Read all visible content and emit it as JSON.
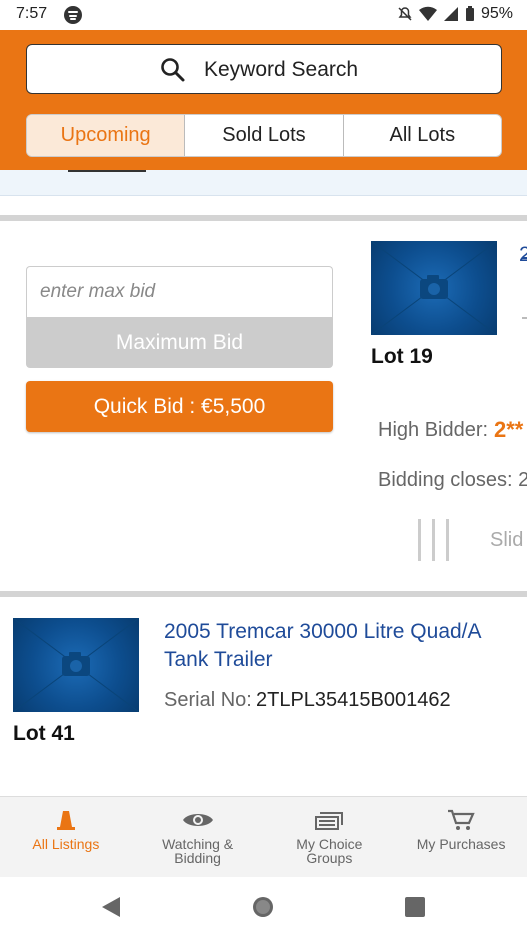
{
  "status_bar": {
    "time": "7:57",
    "battery": "95%"
  },
  "search": {
    "placeholder": "Keyword Search"
  },
  "tabs": [
    {
      "label": "Upcoming",
      "active": true
    },
    {
      "label": "Sold Lots",
      "active": false
    },
    {
      "label": "All Lots",
      "active": false
    }
  ],
  "card1": {
    "max_bid_placeholder": "enter max bid",
    "max_bid_button": "Maximum Bid",
    "quick_bid_button": "Quick Bid : €5,500",
    "title_fragment": "2",
    "lot": "Lot 19",
    "high_bidder_label": "High Bidder:",
    "high_bidder_value": "2**",
    "bidding_closes_label": "Bidding closes: 2",
    "slide_text": "Slid"
  },
  "card2": {
    "title": "2005 Tremcar 30000 Litre Quad/A Tank Trailer",
    "serial_label": "Serial No:",
    "serial_value": "2TLPL35415B001462",
    "lot": "Lot 41"
  },
  "bottom_nav": [
    {
      "label": "All Listings",
      "icon": "cone-icon",
      "active": true
    },
    {
      "label": "Watching & Bidding",
      "icon": "eye-icon",
      "active": false
    },
    {
      "label": "My Choice Groups",
      "icon": "stack-icon",
      "active": false
    },
    {
      "label": "My Purchases",
      "icon": "cart-icon",
      "active": false
    }
  ],
  "colors": {
    "accent": "#ea7514",
    "link": "#1f4b99"
  }
}
